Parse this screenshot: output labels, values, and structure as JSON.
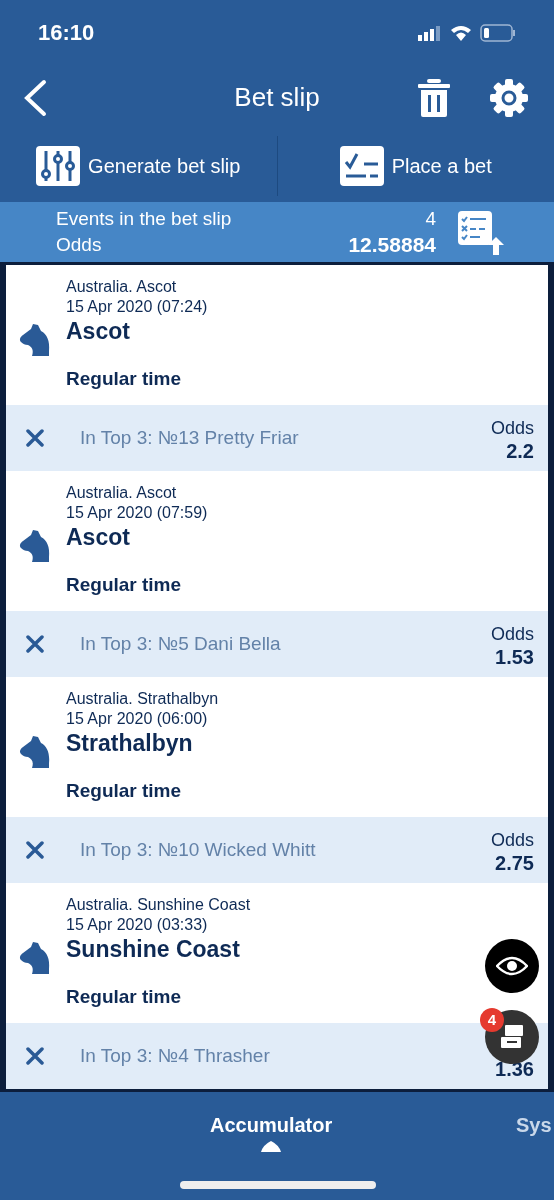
{
  "status_bar": {
    "time": "16:10"
  },
  "header": {
    "title": "Bet slip"
  },
  "actions": [
    {
      "kind": "generate",
      "label": "Generate bet slip"
    },
    {
      "kind": "place",
      "label": "Place a bet"
    }
  ],
  "summary": {
    "events_label": "Events in the bet slip",
    "events_count": "4",
    "odds_label": "Odds",
    "odds_value": "12.58884"
  },
  "events": [
    {
      "location": "Australia. Ascot",
      "date": "15 Apr 2020 (07:24)",
      "title": "Ascot",
      "period": "Regular time",
      "selection": "In Top 3: №13 Pretty Friar",
      "odds_label": "Odds",
      "odds": "2.2"
    },
    {
      "location": "Australia. Ascot",
      "date": "15 Apr 2020 (07:59)",
      "title": "Ascot",
      "period": "Regular time",
      "selection": "In Top 3: №5 Dani Bella",
      "odds_label": "Odds",
      "odds": "1.53"
    },
    {
      "location": "Australia. Strathalbyn",
      "date": "15 Apr 2020 (06:00)",
      "title": "Strathalbyn",
      "period": "Regular time",
      "selection": "In Top 3: №10 Wicked Whitt",
      "odds_label": "Odds",
      "odds": "2.75"
    },
    {
      "location": "Australia. Sunshine Coast",
      "date": "15 Apr 2020 (03:33)",
      "title": "Sunshine Coast",
      "period": "Regular time",
      "selection": "In Top 3: №4 Thrasher",
      "odds": "1.36"
    }
  ],
  "floating": {
    "badge": "4"
  },
  "tabs": [
    {
      "label": "Accumulator",
      "selected": true
    },
    {
      "label": "Sys",
      "selected": false
    }
  ]
}
